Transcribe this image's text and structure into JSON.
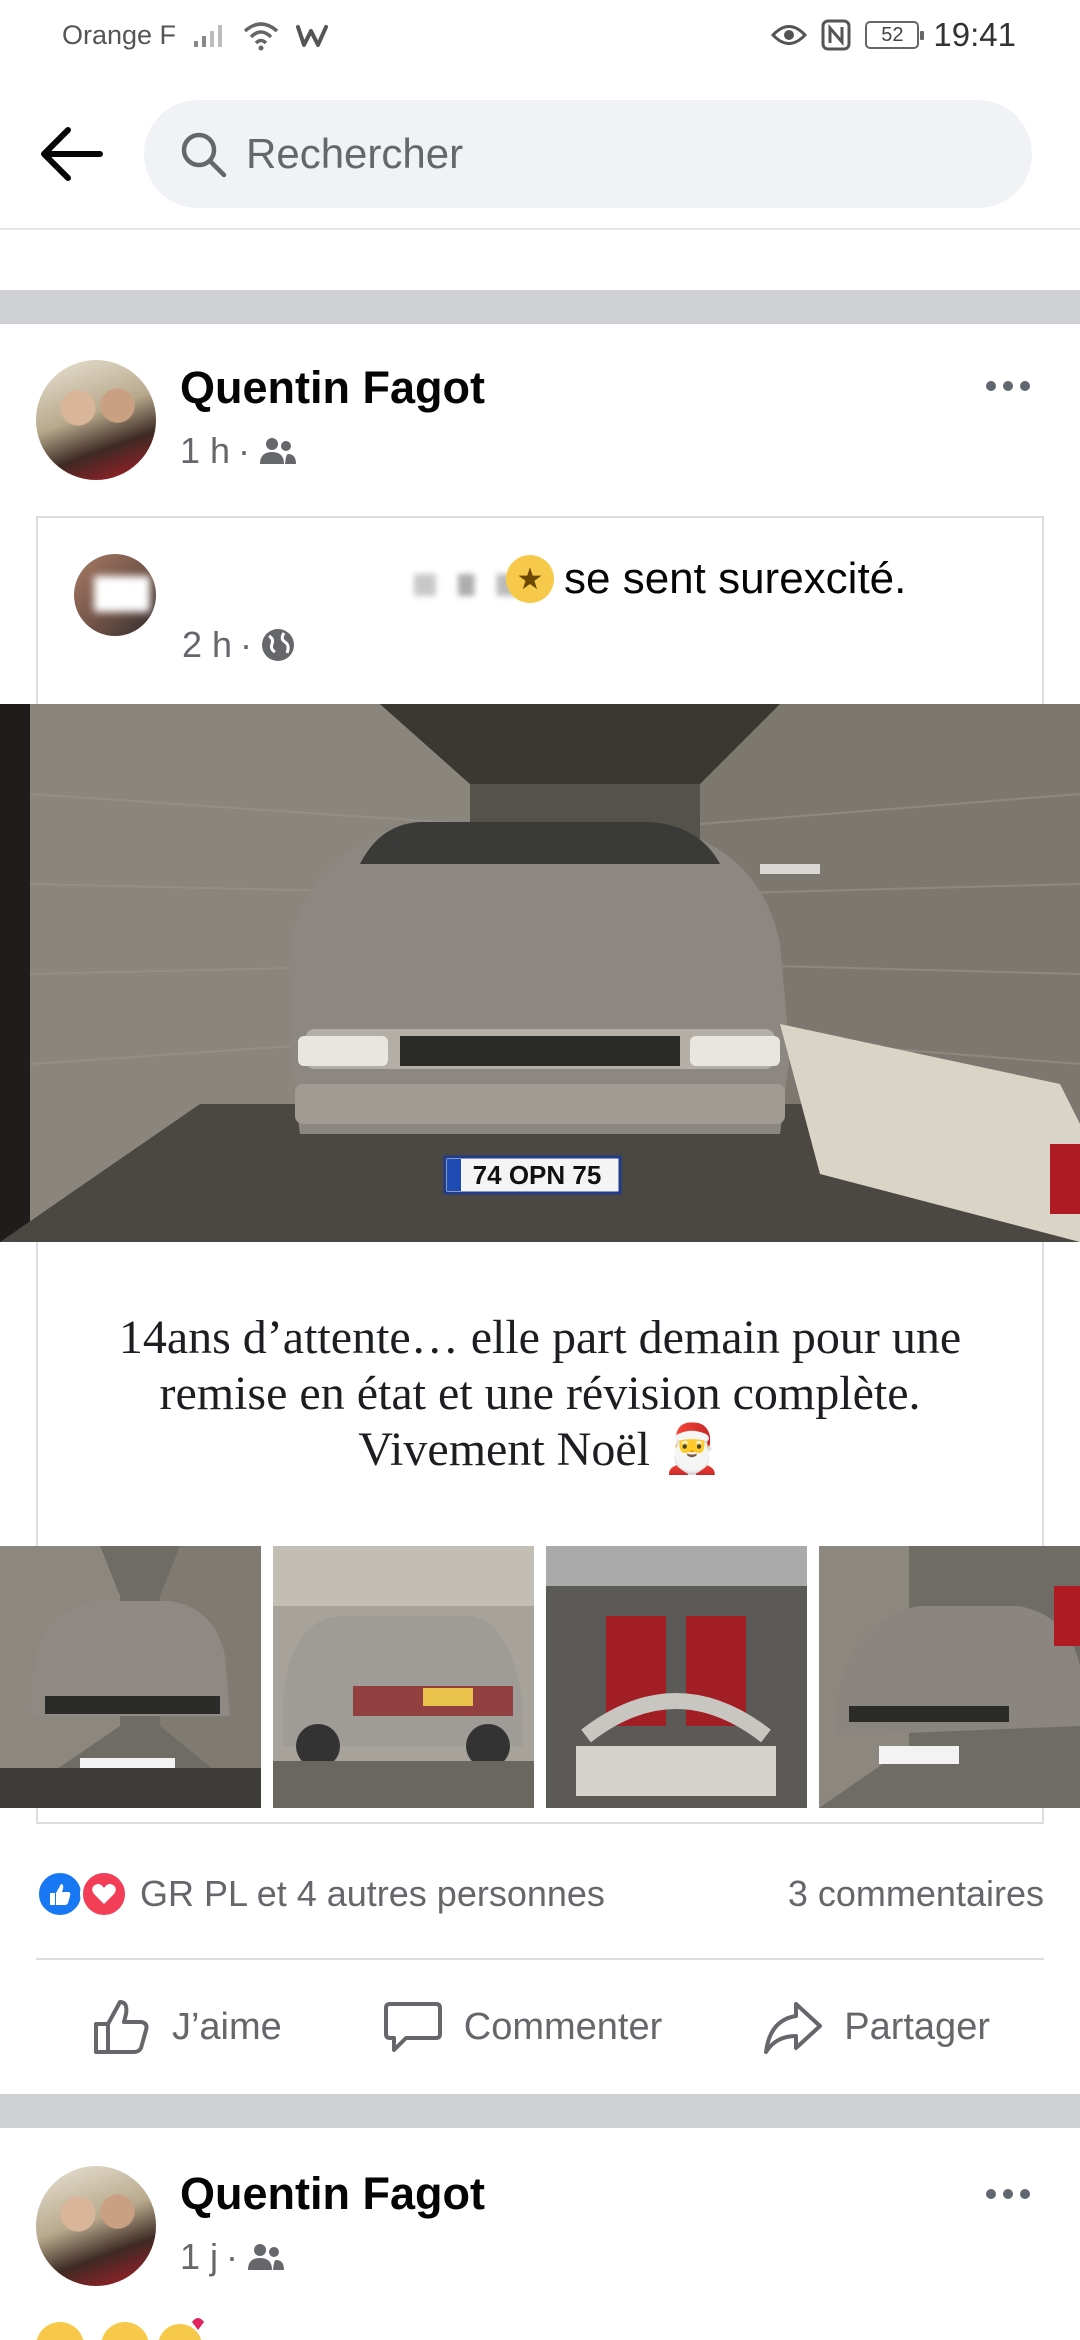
{
  "status_bar": {
    "carrier": "Orange F",
    "battery": "52",
    "time": "19:41"
  },
  "search": {
    "placeholder": "Rechercher"
  },
  "post": {
    "author": "Quentin Fagot",
    "time": "1 h",
    "shared": {
      "feeling": "se sent surexcité.",
      "time": "2 h"
    },
    "caption_lines": [
      "14ans d’attente… elle part demain pour une",
      "remise en état et une révision complète.",
      "Vivement Noël 🎅"
    ],
    "plate": "74 OPN 75",
    "reactions_text": "GR PL et 4 autres personnes",
    "comments_text": "3 commentaires",
    "actions": {
      "like": "J’aime",
      "comment": "Commenter",
      "share": "Partager"
    }
  },
  "next_post": {
    "author": "Quentin Fagot",
    "time": "1 j"
  },
  "colors": {
    "accent_blue": "#1877f2",
    "love_red": "#f33e58",
    "secondary_text": "#65676b",
    "divider_band": "#ced0d4"
  }
}
